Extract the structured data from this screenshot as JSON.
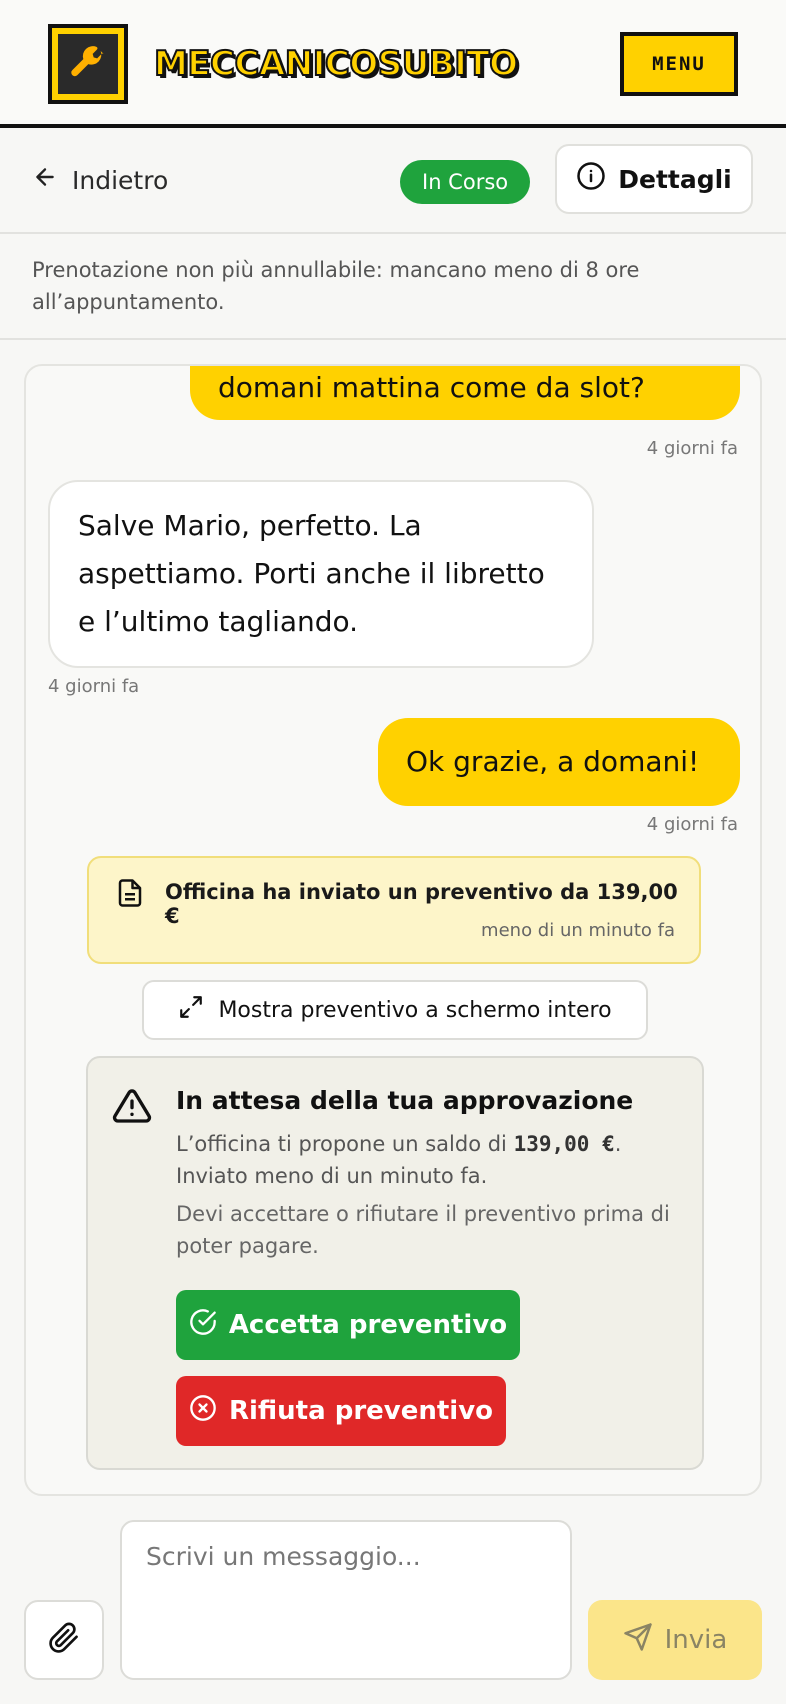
{
  "header": {
    "brand": "MECCANICOSUBITO",
    "menu_label": "MENU",
    "logo_icon": "wrench-icon"
  },
  "subheader": {
    "back_label": "Indietro",
    "status": "In Corso",
    "details_label": "Dettagli"
  },
  "notice": "Prenotazione non più annullabile: mancano meno di 8 ore all’appuntamento.",
  "messages": [
    {
      "direction": "out",
      "text": "domani mattina come da slot?",
      "time": "4 giorni fa"
    },
    {
      "direction": "in",
      "text": "Salve Mario, perfetto. La aspettiamo. Porti anche il libretto e l’ultimo tagliando.",
      "time": "4 giorni fa"
    },
    {
      "direction": "out",
      "text": "Ok grazie, a domani!",
      "time": "4 giorni fa"
    }
  ],
  "quote_notice": {
    "text": "Officina ha inviato un preventivo da 139,00 €",
    "time": "meno di un minuto fa"
  },
  "fullscreen_label": "Mostra preventivo a schermo intero",
  "approval": {
    "title": "In attesa della tua approvazione",
    "line1_prefix": "L’officina ti propone un saldo di ",
    "amount": "139,00 €",
    "line1_suffix": ".",
    "line2": "Inviato meno di un minuto fa.",
    "instruction": "Devi accettare o rifiutare il preventivo prima di poter pagare.",
    "accept_label": "Accetta preventivo",
    "reject_label": "Rifiuta preventivo"
  },
  "composer": {
    "placeholder": "Scrivi un messaggio...",
    "send_label": "Invia"
  },
  "colors": {
    "brand_yellow": "#ffd100",
    "success_green": "#1fa33d",
    "danger_red": "#e02828"
  }
}
